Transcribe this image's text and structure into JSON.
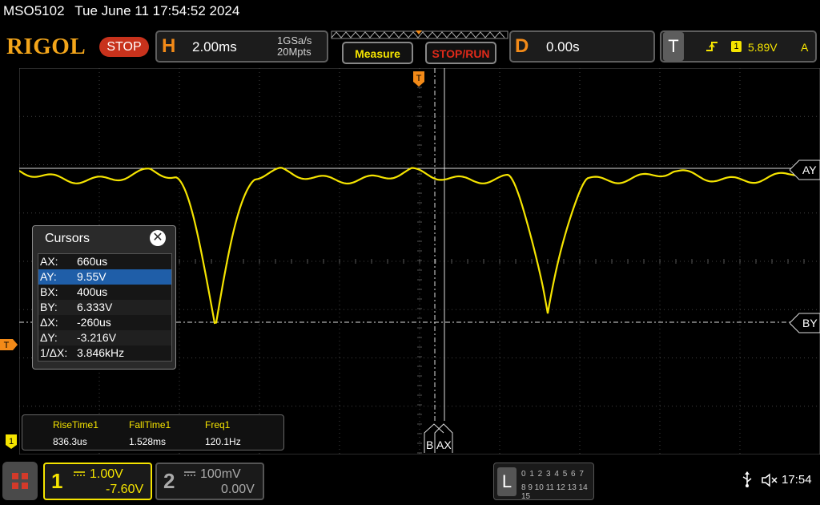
{
  "header": {
    "model": "MSO5102",
    "datetime": "Tue June 11 17:54:52 2024"
  },
  "topbar": {
    "logo": "RIGOL",
    "run_state": "STOP",
    "horizontal": {
      "letter": "H",
      "time_scale": "2.00ms",
      "sample_rate": "1GSa/s",
      "memory_depth": "20Mpts"
    },
    "measure_label": "Measure",
    "stoprun_label": "STOP/RUN",
    "delay": {
      "letter": "D",
      "value": "0.00s"
    },
    "trigger": {
      "letter": "T",
      "source": "1",
      "level": "5.89V",
      "mode": "A"
    }
  },
  "traces": {
    "channel1_color": "#f5e400",
    "cursor_ay_label": "AY",
    "cursor_by_label": "BY",
    "cursor_ax_label": "AX",
    "cursor_bx_label": "B",
    "trigger_marker": "T",
    "ch1_marker": "1"
  },
  "cursors": {
    "title": "Cursors",
    "close": "✕",
    "rows": [
      {
        "key": "AX:",
        "value": "660us"
      },
      {
        "key": "AY:",
        "value": "9.55V"
      },
      {
        "key": "BX:",
        "value": "400us"
      },
      {
        "key": "BY:",
        "value": "6.333V"
      },
      {
        "key": "ΔX:",
        "value": "-260us"
      },
      {
        "key": "ΔY:",
        "value": "-3.216V"
      },
      {
        "key": "1/ΔX:",
        "value": "3.846kHz"
      }
    ]
  },
  "measurements": [
    {
      "name": "RiseTime1",
      "value": "836.3us"
    },
    {
      "name": "FallTime1",
      "value": "1.528ms"
    },
    {
      "name": "Freq1",
      "value": "120.1Hz"
    }
  ],
  "bottombar": {
    "ch1": {
      "num": "1",
      "scale": "1.00V",
      "offset": "-7.60V"
    },
    "ch2": {
      "num": "2",
      "scale": "100mV",
      "offset": "0.00V"
    },
    "la": {
      "letter": "L",
      "row1": "0 1 2 3  4 5 6 7",
      "row2": "8 9 10 11 12 13 14 15"
    },
    "time": "17:54"
  },
  "icons": {
    "menu": "menu-grid-icon",
    "usb": "usb-icon",
    "sound": "mute-icon",
    "close": "close-icon"
  }
}
